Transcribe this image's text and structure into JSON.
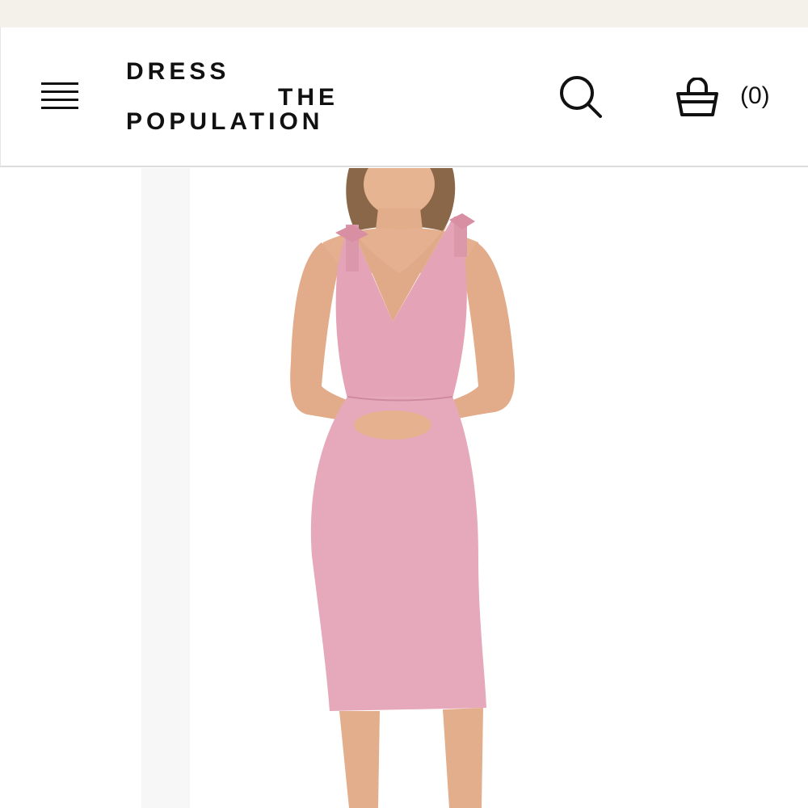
{
  "promo": {
    "text": ""
  },
  "header": {
    "logo": {
      "line1": "DRESS",
      "line2": "THE",
      "line3": "POPULATION"
    },
    "cart_count": "(0)",
    "icons": {
      "menu": "hamburger-menu-icon",
      "search": "search-icon",
      "cart": "shopping-basket-icon"
    }
  },
  "product": {
    "image": "model-in-pink-v-neck-midi-dress",
    "dress_color": "#e4a3b6",
    "background": "#ffffff"
  }
}
